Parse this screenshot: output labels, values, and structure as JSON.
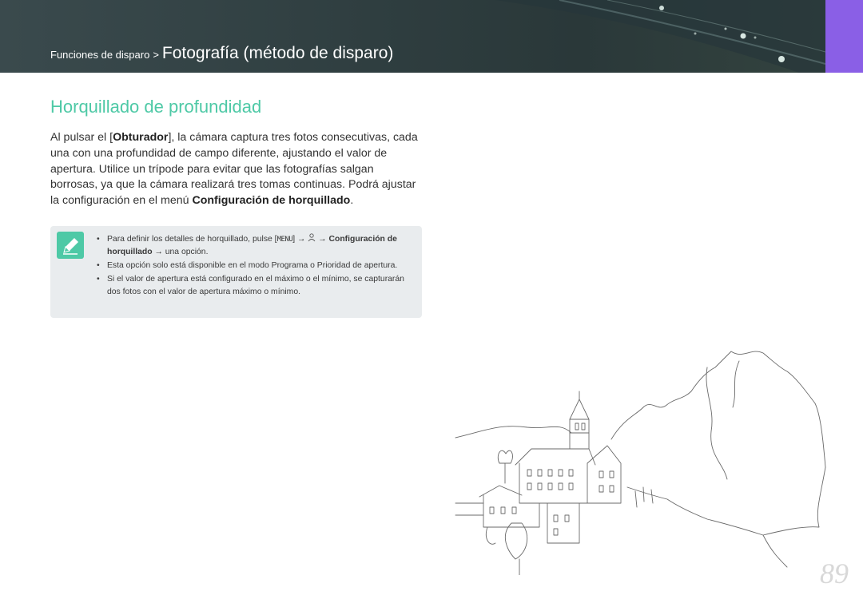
{
  "header": {
    "breadcrumb_parent": "Funciones de disparo",
    "breadcrumb_separator": ">",
    "breadcrumb_current": "Fotografía (método de disparo)",
    "accent_color": "#8a5fe6"
  },
  "section": {
    "title": "Horquillado de profundidad",
    "title_color": "#4ec9a6"
  },
  "body": {
    "p1": "Al pulsar el [",
    "shutter": "Obturador",
    "p2": "], la cámara captura tres fotos consecutivas, cada una con una profundidad de campo diferente, ajustando el valor de apertura. Utilice un trípode para evitar que las fotografías salgan borrosas, ya que la cámara realizará tres tomas continuas. Podrá ajustar la configuración en el menú ",
    "menu_name": "Configuración de horquillado",
    "p3": "."
  },
  "note": {
    "icon": "pencil-note-icon",
    "items": [
      {
        "bullet": "•",
        "pre": "Para definir los detalles de horquillado, pulse [",
        "menu_key": "MENU",
        "mid": "] → ",
        "camera_icon": "camera-icon",
        "arrow": " → ",
        "bold": "Configuración de horquillado",
        "post": " → una opción."
      },
      {
        "bullet": "•",
        "text": "Esta opción solo está disponible en el modo Programa o Prioridad de apertura."
      },
      {
        "bullet": "•",
        "text": "Si el valor de apertura está configurado en el máximo o el mínimo, se capturarán dos fotos con el valor de apertura máximo o mínimo."
      }
    ]
  },
  "page_number": "89"
}
